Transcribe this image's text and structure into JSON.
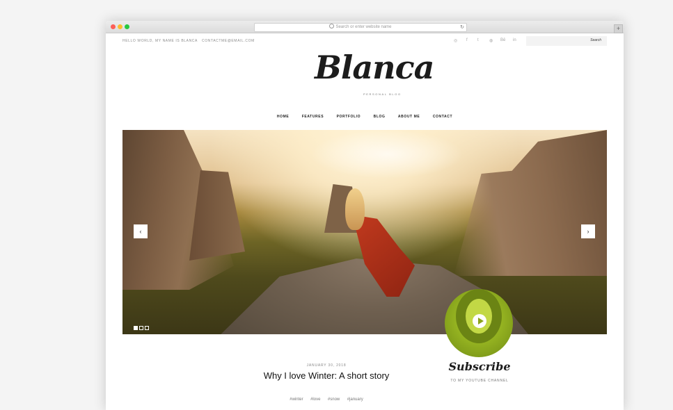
{
  "browser": {
    "url_placeholder": "Search or enter website name",
    "reload_icon": "reload-icon"
  },
  "topbar": {
    "greeting": "HELLO WORLD, MY NAME IS BLANCA",
    "email": "CONTACTME@EMAIL.COM",
    "social_icons": [
      "instagram-icon",
      "facebook-icon",
      "twitter-icon",
      "dribbble-icon",
      "behance-icon",
      "linkedin-icon"
    ],
    "social_glyphs": [
      "◎",
      "f",
      "t",
      "◍",
      "Bē",
      "in"
    ],
    "search_button": "Search"
  },
  "brand": {
    "logo": "Blanca",
    "tagline": "PERSONAL BLOG"
  },
  "nav": {
    "items": [
      "HOME",
      "FEATURES",
      "PORTFOLIO",
      "BLOG",
      "ABOUT ME",
      "CONTACT"
    ]
  },
  "slider": {
    "prev": "‹",
    "next": "›",
    "dots": 3,
    "active_dot": 1
  },
  "post": {
    "date": "JANUARY 30, 2018",
    "title": "Why I love Winter: A short story",
    "tags": [
      "#winter",
      "#love",
      "#snow",
      "#january"
    ]
  },
  "subscribe": {
    "title": "Subscribe",
    "subtitle": "TO MY YOUTUBE CHANNEL"
  }
}
